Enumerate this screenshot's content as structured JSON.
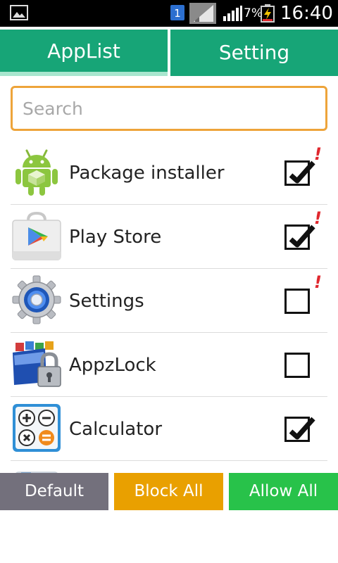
{
  "status_bar": {
    "sim_slot": "1",
    "battery_percent": "7%",
    "time": "16:40"
  },
  "tabs": [
    {
      "label": "AppList",
      "selected": true
    },
    {
      "label": "Setting",
      "selected": false
    }
  ],
  "search": {
    "placeholder": "Search",
    "value": ""
  },
  "apps": [
    {
      "name": "Package installer",
      "icon": "android-package-icon",
      "checked": true,
      "warning": true
    },
    {
      "name": "Play Store",
      "icon": "play-store-icon",
      "checked": true,
      "warning": true
    },
    {
      "name": "Settings",
      "icon": "settings-gear-icon",
      "checked": false,
      "warning": true
    },
    {
      "name": "AppzLock",
      "icon": "appzlock-icon",
      "checked": false,
      "warning": false
    },
    {
      "name": "Calculator",
      "icon": "calculator-icon",
      "checked": true,
      "warning": false
    }
  ],
  "warning_mark": "!",
  "buttons": {
    "default_label": "Default",
    "block_all_label": "Block All",
    "allow_all_label": "Allow All"
  },
  "colors": {
    "tab_green": "#17a577",
    "search_border": "#eea43a",
    "default_button": "#73707c",
    "block_button": "#e9a000",
    "allow_button": "#28c24a",
    "warning_red": "#e0282e"
  }
}
